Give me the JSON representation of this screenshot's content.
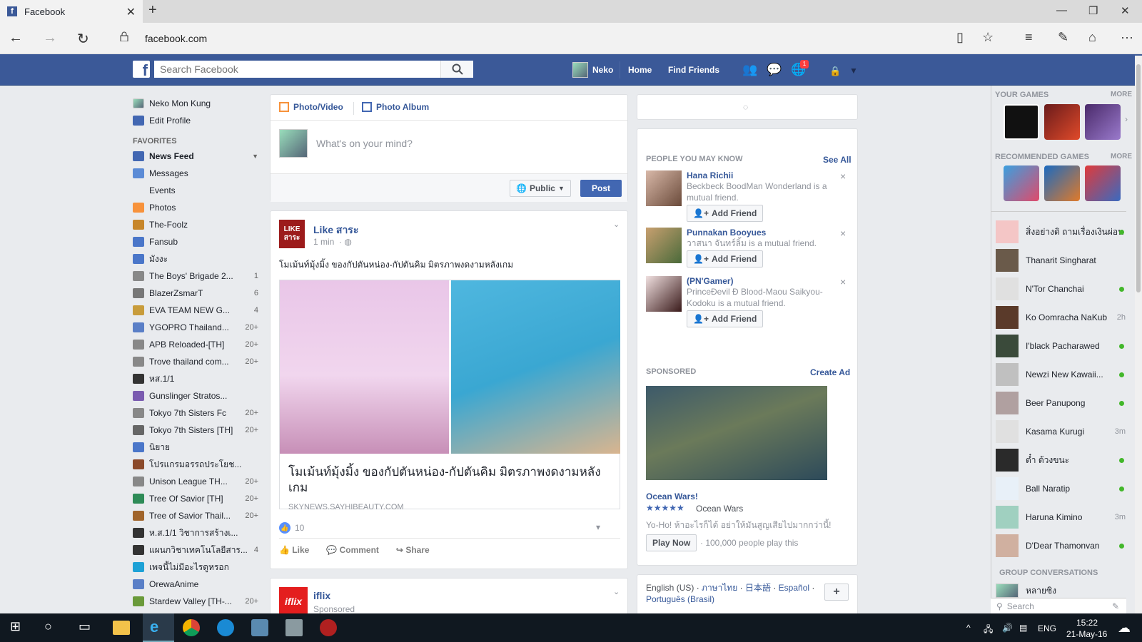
{
  "browser": {
    "tab_title": "Facebook",
    "url": "facebook.com"
  },
  "topbar": {
    "search_placeholder": "Search Facebook",
    "user": "Neko",
    "home": "Home",
    "find_friends": "Find Friends",
    "notif_count": "1"
  },
  "leftnav": {
    "profile": "Neko Mon Kung",
    "edit_profile": "Edit Profile",
    "favorites_title": "FAVORITES",
    "items": [
      {
        "label": "News Feed",
        "count": "",
        "color": "#4267b2"
      },
      {
        "label": "Messages",
        "count": "",
        "color": "#5b8bd6"
      },
      {
        "label": "Events",
        "count": "",
        "color": "#e9ebee"
      },
      {
        "label": "Photos",
        "count": "",
        "color": "#f7923b"
      },
      {
        "label": "The-Foolz",
        "count": "",
        "color": "#c7862a"
      },
      {
        "label": "Fansub",
        "count": "",
        "color": "#4a76c9"
      },
      {
        "label": "มังงะ",
        "count": "",
        "color": "#4a76c9"
      },
      {
        "label": "The Boys' Brigade 2...",
        "count": "1",
        "color": "#888"
      },
      {
        "label": "BlazerZsmarT",
        "count": "6",
        "color": "#777"
      },
      {
        "label": "EVA TEAM NEW G...",
        "count": "4",
        "color": "#c89c3b"
      },
      {
        "label": "YGOPRO Thailand...",
        "count": "20+",
        "color": "#5a7fc7"
      },
      {
        "label": "APB Reloaded-[TH]",
        "count": "20+",
        "color": "#888"
      },
      {
        "label": "Trove thailand com...",
        "count": "20+",
        "color": "#888"
      },
      {
        "label": "หส.1/1",
        "count": "",
        "color": "#333"
      },
      {
        "label": "Gunslinger Stratos...",
        "count": "",
        "color": "#7a5bb0"
      },
      {
        "label": "Tokyo 7th Sisters Fc",
        "count": "20+",
        "color": "#888"
      },
      {
        "label": "Tokyo 7th Sisters [TH]",
        "count": "20+",
        "color": "#666"
      },
      {
        "label": "นิยาย",
        "count": "",
        "color": "#4a76c9"
      },
      {
        "label": "โปรแกรมอรรถประโยช...",
        "count": "",
        "color": "#8b4a2b"
      },
      {
        "label": "Unison League TH...",
        "count": "20+",
        "color": "#888"
      },
      {
        "label": "Tree Of Savior [TH]",
        "count": "20+",
        "color": "#2e8b57"
      },
      {
        "label": "Tree of Savior Thail...",
        "count": "20+",
        "color": "#a0642a"
      },
      {
        "label": "ห.ส.1/1 วิชาการสร้างเ...",
        "count": "",
        "color": "#333"
      },
      {
        "label": "แผนกวิชาเทคโนโลยีสาร...",
        "count": "4",
        "color": "#333"
      },
      {
        "label": "เพจนี้ไม่มีอะไรดูหรอก",
        "count": "",
        "color": "#1da1d6"
      },
      {
        "label": "OrewaAnime",
        "count": "",
        "color": "#5a7fc7"
      },
      {
        "label": "Stardew Valley [TH-...",
        "count": "20+",
        "color": "#6a9a3a"
      }
    ]
  },
  "composer": {
    "photo_video": "Photo/Video",
    "photo_album": "Photo Album",
    "placeholder": "What's on your mind?",
    "privacy": "Public",
    "post": "Post"
  },
  "post1": {
    "page": "Like สาระ",
    "time": "1 min",
    "text": "โมเม้นท์มุ้งมิ้ง ของกัปตันหน่อง-กัปตันคิม มิตรภาพงดงามหลังเกม",
    "link_title": "โมเม้นท์มุ้งมิ้ง ของกัปตันหน่อง-กัปตันคิม มิตรภาพงดงามหลังเกม",
    "link_domain": "SKYNEWS.SAYHIBEAUTY.COM",
    "likes": "10",
    "like": "Like",
    "comment": "Comment",
    "share": "Share",
    "logo_text": "LIKE สาระ"
  },
  "post2": {
    "page": "iflix",
    "sub": "Sponsored",
    "logo_text": "iflix"
  },
  "rightcol": {
    "pymk_title": "PEOPLE YOU MAY KNOW",
    "see_all": "See All",
    "add_friend": "Add Friend",
    "people": [
      {
        "name": "Hana Richii",
        "desc": "Beckbeck BoodMan Wonderland is a mutual friend."
      },
      {
        "name": "Punnakan Booyues",
        "desc": "วาสนา จันทร์ลิ้ม is a mutual friend."
      },
      {
        "name": "(PN'Gamer)",
        "desc": "PrinceĐevil Đ Blood-Maou Saikyou-Kodoku is a mutual friend."
      }
    ],
    "sponsored": "SPONSORED",
    "create_ad": "Create Ad",
    "ad_title": "Ocean Wars!",
    "ad_stars": "★★★★★",
    "ad_app": "Ocean Wars",
    "ad_text": "Yo-Ho! ห้าอะไรก็ได้ อย่าให้มันสูญเสียไปมากกว่านี้!",
    "play_now": "Play Now",
    "play_count": "· 100,000 people play this",
    "lang1": "English (US)",
    "lang2": "ภาษาไทย",
    "lang3": "日本語",
    "lang4": "Español",
    "lang5": "Português (Brasil)",
    "plus": "+"
  },
  "sidebar": {
    "your_games": "YOUR GAMES",
    "more": "MORE",
    "recommended_games": "RECOMMENDED GAMES",
    "contacts": [
      {
        "name": "สิ่งอย่างดิ ถามเรื่องเงินผ่อน",
        "status": "online"
      },
      {
        "name": "Thanarit Singharat",
        "status": ""
      },
      {
        "name": "N'Tor Chanchai",
        "status": "online"
      },
      {
        "name": "Ko Oomracha NaKub",
        "status": "2h"
      },
      {
        "name": "I'black Pacharawed",
        "status": "online"
      },
      {
        "name": "Newzi New Kawaii...",
        "status": "online"
      },
      {
        "name": "Beer Panupong",
        "status": "online"
      },
      {
        "name": "Kasama Kurugi",
        "status": "3m"
      },
      {
        "name": "ต๋ำ ต้วงขนะ",
        "status": "online"
      },
      {
        "name": "Ball Naratip",
        "status": "online"
      },
      {
        "name": "Haruna Kimino",
        "status": "3m"
      },
      {
        "name": "D'Dear Thamonvan",
        "status": "online"
      }
    ],
    "group_conversations": "GROUP CONVERSATIONS",
    "group1": "หลายซิง",
    "search_placeholder": "Search"
  },
  "taskbar": {
    "lang": "ENG",
    "time": "15:22",
    "date": "21-May-16"
  }
}
